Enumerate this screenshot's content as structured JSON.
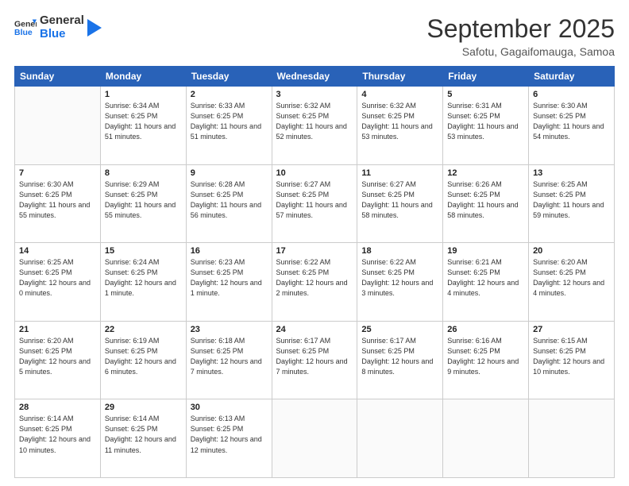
{
  "header": {
    "logo_line1": "General",
    "logo_line2": "Blue",
    "title": "September 2025",
    "location": "Safotu, Gagaifomauga, Samoa"
  },
  "weekdays": [
    "Sunday",
    "Monday",
    "Tuesday",
    "Wednesday",
    "Thursday",
    "Friday",
    "Saturday"
  ],
  "weeks": [
    [
      {
        "day": "",
        "sunrise": "",
        "sunset": "",
        "daylight": ""
      },
      {
        "day": "1",
        "sunrise": "Sunrise: 6:34 AM",
        "sunset": "Sunset: 6:25 PM",
        "daylight": "Daylight: 11 hours and 51 minutes."
      },
      {
        "day": "2",
        "sunrise": "Sunrise: 6:33 AM",
        "sunset": "Sunset: 6:25 PM",
        "daylight": "Daylight: 11 hours and 51 minutes."
      },
      {
        "day": "3",
        "sunrise": "Sunrise: 6:32 AM",
        "sunset": "Sunset: 6:25 PM",
        "daylight": "Daylight: 11 hours and 52 minutes."
      },
      {
        "day": "4",
        "sunrise": "Sunrise: 6:32 AM",
        "sunset": "Sunset: 6:25 PM",
        "daylight": "Daylight: 11 hours and 53 minutes."
      },
      {
        "day": "5",
        "sunrise": "Sunrise: 6:31 AM",
        "sunset": "Sunset: 6:25 PM",
        "daylight": "Daylight: 11 hours and 53 minutes."
      },
      {
        "day": "6",
        "sunrise": "Sunrise: 6:30 AM",
        "sunset": "Sunset: 6:25 PM",
        "daylight": "Daylight: 11 hours and 54 minutes."
      }
    ],
    [
      {
        "day": "7",
        "sunrise": "Sunrise: 6:30 AM",
        "sunset": "Sunset: 6:25 PM",
        "daylight": "Daylight: 11 hours and 55 minutes."
      },
      {
        "day": "8",
        "sunrise": "Sunrise: 6:29 AM",
        "sunset": "Sunset: 6:25 PM",
        "daylight": "Daylight: 11 hours and 55 minutes."
      },
      {
        "day": "9",
        "sunrise": "Sunrise: 6:28 AM",
        "sunset": "Sunset: 6:25 PM",
        "daylight": "Daylight: 11 hours and 56 minutes."
      },
      {
        "day": "10",
        "sunrise": "Sunrise: 6:27 AM",
        "sunset": "Sunset: 6:25 PM",
        "daylight": "Daylight: 11 hours and 57 minutes."
      },
      {
        "day": "11",
        "sunrise": "Sunrise: 6:27 AM",
        "sunset": "Sunset: 6:25 PM",
        "daylight": "Daylight: 11 hours and 58 minutes."
      },
      {
        "day": "12",
        "sunrise": "Sunrise: 6:26 AM",
        "sunset": "Sunset: 6:25 PM",
        "daylight": "Daylight: 11 hours and 58 minutes."
      },
      {
        "day": "13",
        "sunrise": "Sunrise: 6:25 AM",
        "sunset": "Sunset: 6:25 PM",
        "daylight": "Daylight: 11 hours and 59 minutes."
      }
    ],
    [
      {
        "day": "14",
        "sunrise": "Sunrise: 6:25 AM",
        "sunset": "Sunset: 6:25 PM",
        "daylight": "Daylight: 12 hours and 0 minutes."
      },
      {
        "day": "15",
        "sunrise": "Sunrise: 6:24 AM",
        "sunset": "Sunset: 6:25 PM",
        "daylight": "Daylight: 12 hours and 1 minute."
      },
      {
        "day": "16",
        "sunrise": "Sunrise: 6:23 AM",
        "sunset": "Sunset: 6:25 PM",
        "daylight": "Daylight: 12 hours and 1 minute."
      },
      {
        "day": "17",
        "sunrise": "Sunrise: 6:22 AM",
        "sunset": "Sunset: 6:25 PM",
        "daylight": "Daylight: 12 hours and 2 minutes."
      },
      {
        "day": "18",
        "sunrise": "Sunrise: 6:22 AM",
        "sunset": "Sunset: 6:25 PM",
        "daylight": "Daylight: 12 hours and 3 minutes."
      },
      {
        "day": "19",
        "sunrise": "Sunrise: 6:21 AM",
        "sunset": "Sunset: 6:25 PM",
        "daylight": "Daylight: 12 hours and 4 minutes."
      },
      {
        "day": "20",
        "sunrise": "Sunrise: 6:20 AM",
        "sunset": "Sunset: 6:25 PM",
        "daylight": "Daylight: 12 hours and 4 minutes."
      }
    ],
    [
      {
        "day": "21",
        "sunrise": "Sunrise: 6:20 AM",
        "sunset": "Sunset: 6:25 PM",
        "daylight": "Daylight: 12 hours and 5 minutes."
      },
      {
        "day": "22",
        "sunrise": "Sunrise: 6:19 AM",
        "sunset": "Sunset: 6:25 PM",
        "daylight": "Daylight: 12 hours and 6 minutes."
      },
      {
        "day": "23",
        "sunrise": "Sunrise: 6:18 AM",
        "sunset": "Sunset: 6:25 PM",
        "daylight": "Daylight: 12 hours and 7 minutes."
      },
      {
        "day": "24",
        "sunrise": "Sunrise: 6:17 AM",
        "sunset": "Sunset: 6:25 PM",
        "daylight": "Daylight: 12 hours and 7 minutes."
      },
      {
        "day": "25",
        "sunrise": "Sunrise: 6:17 AM",
        "sunset": "Sunset: 6:25 PM",
        "daylight": "Daylight: 12 hours and 8 minutes."
      },
      {
        "day": "26",
        "sunrise": "Sunrise: 6:16 AM",
        "sunset": "Sunset: 6:25 PM",
        "daylight": "Daylight: 12 hours and 9 minutes."
      },
      {
        "day": "27",
        "sunrise": "Sunrise: 6:15 AM",
        "sunset": "Sunset: 6:25 PM",
        "daylight": "Daylight: 12 hours and 10 minutes."
      }
    ],
    [
      {
        "day": "28",
        "sunrise": "Sunrise: 6:14 AM",
        "sunset": "Sunset: 6:25 PM",
        "daylight": "Daylight: 12 hours and 10 minutes."
      },
      {
        "day": "29",
        "sunrise": "Sunrise: 6:14 AM",
        "sunset": "Sunset: 6:25 PM",
        "daylight": "Daylight: 12 hours and 11 minutes."
      },
      {
        "day": "30",
        "sunrise": "Sunrise: 6:13 AM",
        "sunset": "Sunset: 6:25 PM",
        "daylight": "Daylight: 12 hours and 12 minutes."
      },
      {
        "day": "",
        "sunrise": "",
        "sunset": "",
        "daylight": ""
      },
      {
        "day": "",
        "sunrise": "",
        "sunset": "",
        "daylight": ""
      },
      {
        "day": "",
        "sunrise": "",
        "sunset": "",
        "daylight": ""
      },
      {
        "day": "",
        "sunrise": "",
        "sunset": "",
        "daylight": ""
      }
    ]
  ]
}
